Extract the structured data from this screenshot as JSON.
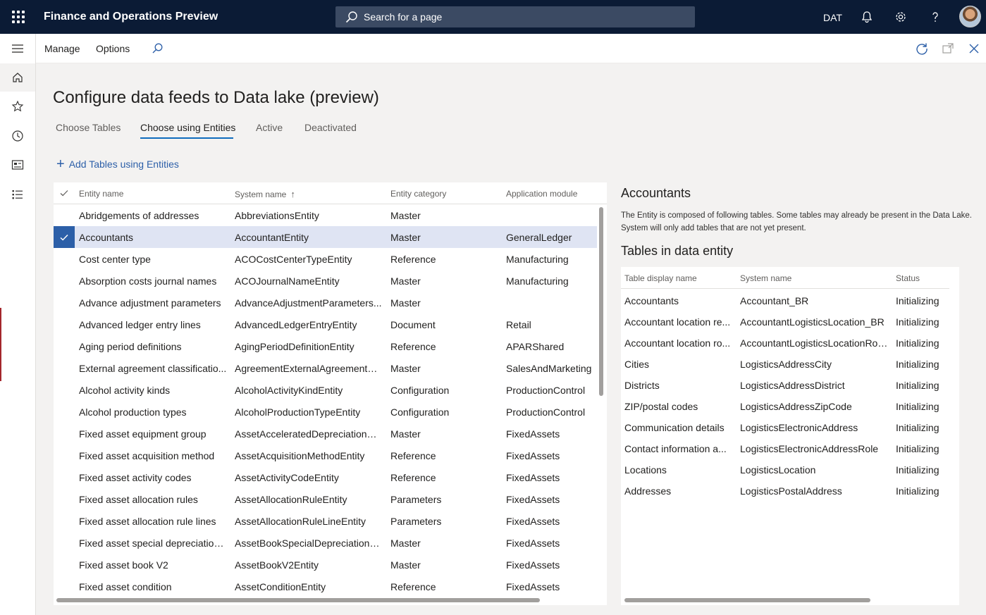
{
  "app": {
    "title": "Finance and Operations Preview",
    "company": "DAT"
  },
  "search": {
    "placeholder": "Search for a page"
  },
  "actionbar": {
    "manage_label": "Manage",
    "options_label": "Options"
  },
  "page": {
    "title": "Configure data feeds to Data lake (preview)",
    "tabs": [
      "Choose Tables",
      "Choose using Entities",
      "Active",
      "Deactivated"
    ],
    "active_tab": "Choose using Entities",
    "add_link": "Add Tables using Entities"
  },
  "entity_grid": {
    "headers": [
      "Entity name",
      "System name",
      "Entity category",
      "Application module"
    ],
    "sorted_column": "System name",
    "selected_row": "Accountants",
    "rows": [
      [
        "Abridgements of addresses",
        "AbbreviationsEntity",
        "Master",
        ""
      ],
      [
        "Accountants",
        "AccountantEntity",
        "Master",
        "GeneralLedger"
      ],
      [
        "Cost center type",
        "ACOCostCenterTypeEntity",
        "Reference",
        "Manufacturing"
      ],
      [
        "Absorption costs journal names",
        "ACOJournalNameEntity",
        "Master",
        "Manufacturing"
      ],
      [
        "Advance adjustment parameters",
        "AdvanceAdjustmentParameters...",
        "Master",
        ""
      ],
      [
        "Advanced ledger entry lines",
        "AdvancedLedgerEntryEntity",
        "Document",
        "Retail"
      ],
      [
        "Aging period definitions",
        "AgingPeriodDefinitionEntity",
        "Reference",
        "APARShared"
      ],
      [
        "External agreement classificatio...",
        "AgreementExternalAgreementCl...",
        "Master",
        "SalesAndMarketing"
      ],
      [
        "Alcohol activity kinds",
        "AlcoholActivityKindEntity",
        "Configuration",
        "ProductionControl"
      ],
      [
        "Alcohol production types",
        "AlcoholProductionTypeEntity",
        "Configuration",
        "ProductionControl"
      ],
      [
        "Fixed asset equipment group",
        "AssetAcceleratedDepreciationGr...",
        "Master",
        "FixedAssets"
      ],
      [
        "Fixed asset acquisition method",
        "AssetAcquisitionMethodEntity",
        "Reference",
        "FixedAssets"
      ],
      [
        "Fixed asset activity codes",
        "AssetActivityCodeEntity",
        "Reference",
        "FixedAssets"
      ],
      [
        "Fixed asset allocation rules",
        "AssetAllocationRuleEntity",
        "Parameters",
        "FixedAssets"
      ],
      [
        "Fixed asset allocation rule lines",
        "AssetAllocationRuleLineEntity",
        "Parameters",
        "FixedAssets"
      ],
      [
        "Fixed asset special depreciation ...",
        "AssetBookSpecialDepreciationAl...",
        "Master",
        "FixedAssets"
      ],
      [
        "Fixed asset book V2",
        "AssetBookV2Entity",
        "Master",
        "FixedAssets"
      ],
      [
        "Fixed asset condition",
        "AssetConditionEntity",
        "Reference",
        "FixedAssets"
      ]
    ]
  },
  "detail": {
    "title": "Accountants",
    "description": "The Entity is composed of following tables. Some tables may already be present in the Data Lake. System will only add tables that are not yet present.",
    "subtitle": "Tables in data entity",
    "headers": [
      "Table display name",
      "System name",
      "Status"
    ],
    "rows": [
      [
        "Accountants",
        "Accountant_BR",
        "Initializing"
      ],
      [
        "Accountant location re...",
        "AccountantLogisticsLocation_BR",
        "Initializing"
      ],
      [
        "Accountant location ro...",
        "AccountantLogisticsLocationRol...",
        "Initializing"
      ],
      [
        "Cities",
        "LogisticsAddressCity",
        "Initializing"
      ],
      [
        "Districts",
        "LogisticsAddressDistrict",
        "Initializing"
      ],
      [
        "ZIP/postal codes",
        "LogisticsAddressZipCode",
        "Initializing"
      ],
      [
        "Communication details",
        "LogisticsElectronicAddress",
        "Initializing"
      ],
      [
        "Contact information a...",
        "LogisticsElectronicAddressRole",
        "Initializing"
      ],
      [
        "Locations",
        "LogisticsLocation",
        "Initializing"
      ],
      [
        "Addresses",
        "LogisticsPostalAddress",
        "Initializing"
      ]
    ]
  },
  "icons": {
    "topbar": [
      "waffle-icon",
      "search-icon",
      "bell-icon",
      "gear-icon",
      "help-icon"
    ],
    "leftnav": [
      "hamburger-icon",
      "home-icon",
      "star-icon",
      "clock-icon",
      "workspace-icon",
      "modules-icon"
    ],
    "actionbar": [
      "search-icon",
      "refresh-icon",
      "open-new-icon",
      "close-icon"
    ]
  },
  "colors": {
    "topbar": "#0b1b35",
    "accent": "#2c5fa8",
    "selected_row": "#dfe4f3",
    "tab_underline": "#0f6cbd"
  }
}
